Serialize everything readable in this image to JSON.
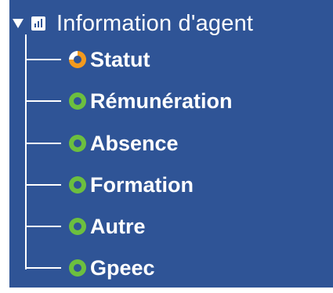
{
  "tree": {
    "root": {
      "label": "Information d'agent",
      "expanded": true,
      "toggle_icon": "caret-down-icon",
      "icon": "chart-icon"
    },
    "items": [
      {
        "label": "Statut",
        "status": "in-progress",
        "status_color": "#f39a1e",
        "icon": "status-ring-icon"
      },
      {
        "label": "Rémunération",
        "status": "complete",
        "status_color": "#6cbf3f",
        "icon": "status-ring-icon"
      },
      {
        "label": "Absence",
        "status": "complete",
        "status_color": "#6cbf3f",
        "icon": "status-ring-icon"
      },
      {
        "label": "Formation",
        "status": "complete",
        "status_color": "#6cbf3f",
        "icon": "status-ring-icon"
      },
      {
        "label": "Autre",
        "status": "complete",
        "status_color": "#6cbf3f",
        "icon": "status-ring-icon"
      },
      {
        "label": "Gpeec",
        "status": "complete",
        "status_color": "#6cbf3f",
        "icon": "status-ring-icon"
      }
    ]
  },
  "colors": {
    "panel_background": "#2f5496",
    "text": "#ffffff",
    "in_progress": "#f39a1e",
    "complete": "#6cbf3f"
  }
}
